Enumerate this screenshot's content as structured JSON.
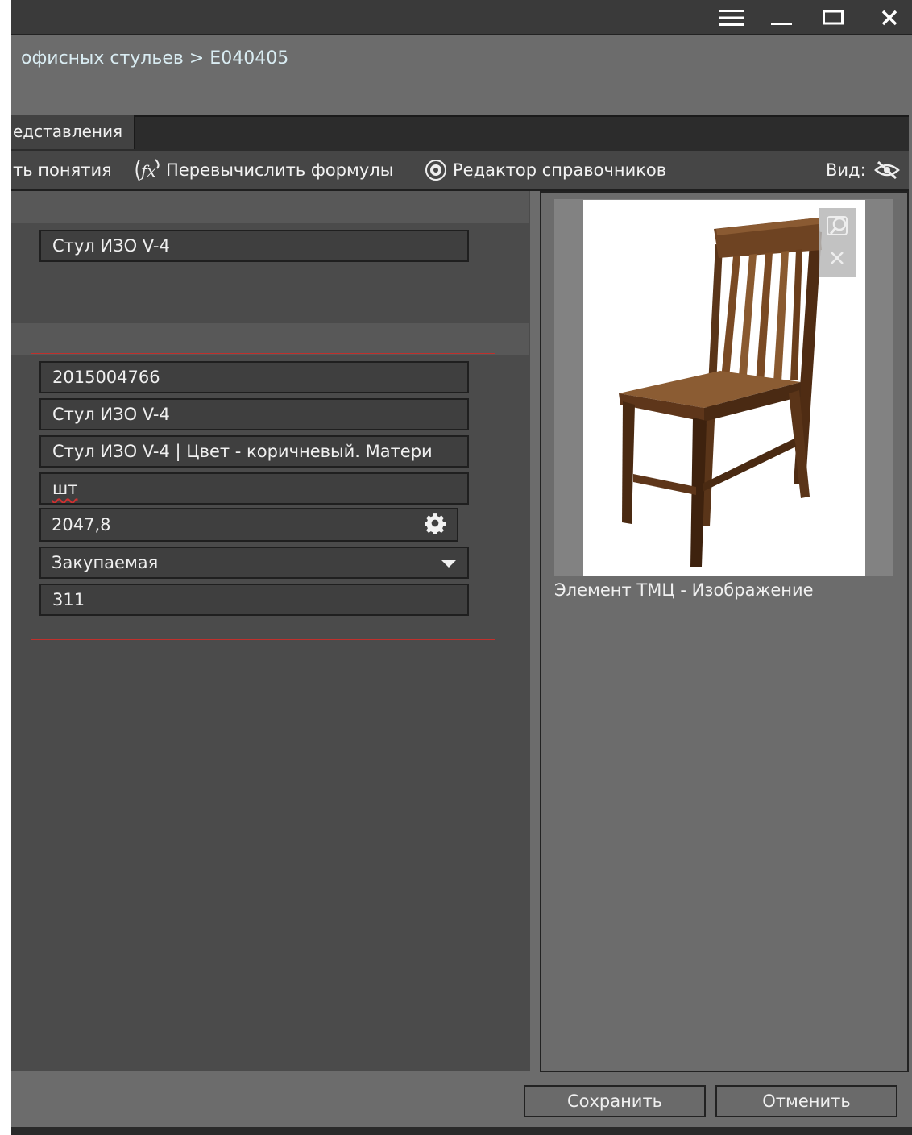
{
  "breadcrumb": "офисных стульев > Е040405",
  "tabs": [
    {
      "label": "едставления"
    }
  ],
  "toolbar": {
    "item1_label": "ть понятия",
    "recalc_label": "Перевычислить формулы",
    "dict_editor_label": "Редактор справочников",
    "view_label": "Вид:",
    "recalc_icon": "fx-icon",
    "dict_editor_icon": "gear-icon",
    "view_icon": "eye-slash-icon"
  },
  "fields": {
    "name": "Стул ИЗО V-4",
    "code": "2015004766",
    "short_name": "Стул ИЗО V-4",
    "full_name": "Стул ИЗО V-4 | Цвет - коричневый. Матери",
    "unit": "шт",
    "price": "2047,8",
    "type": "Закупаемая",
    "account": "311"
  },
  "image": {
    "caption": "Элемент ТМЦ  -  Изображение",
    "zoom_icon": "zoom-icon",
    "remove_icon": "close-icon"
  },
  "footer": {
    "save_label": "Сохранить",
    "cancel_label": "Отменить"
  },
  "window_controls": [
    "menu-icon",
    "minimize-icon",
    "maximize-icon",
    "close-icon"
  ]
}
